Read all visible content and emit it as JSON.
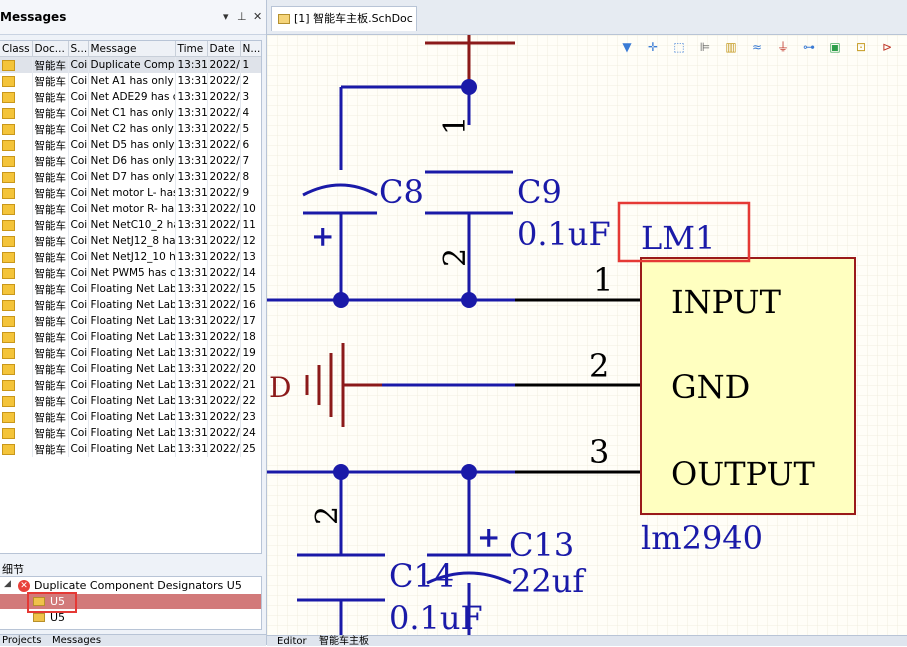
{
  "messages_panel": {
    "title": "Messages",
    "pin_icon": "pin-icon",
    "close_label": "✕",
    "dropdown_label": "▾",
    "columns": [
      "Class",
      "Doc...",
      "S...",
      "Message",
      "Time",
      "Date",
      "N..."
    ],
    "rows": [
      {
        "doc": "智能车",
        "src": "Coi",
        "msg": "Duplicate Comp",
        "time": "13:31",
        "date": "2022/",
        "no": "1"
      },
      {
        "doc": "智能车",
        "src": "Coi",
        "msg": "Net A1 has only",
        "time": "13:31",
        "date": "2022/",
        "no": "2"
      },
      {
        "doc": "智能车",
        "src": "Coi",
        "msg": "Net ADE29 has c",
        "time": "13:31",
        "date": "2022/",
        "no": "3"
      },
      {
        "doc": "智能车",
        "src": "Coi",
        "msg": "Net C1 has only",
        "time": "13:31",
        "date": "2022/",
        "no": "4"
      },
      {
        "doc": "智能车",
        "src": "Coi",
        "msg": "Net C2 has only",
        "time": "13:31",
        "date": "2022/",
        "no": "5"
      },
      {
        "doc": "智能车",
        "src": "Coi",
        "msg": "Net D5 has only",
        "time": "13:31",
        "date": "2022/",
        "no": "6"
      },
      {
        "doc": "智能车",
        "src": "Coi",
        "msg": "Net D6 has only",
        "time": "13:31",
        "date": "2022/",
        "no": "7"
      },
      {
        "doc": "智能车",
        "src": "Coi",
        "msg": "Net D7 has only",
        "time": "13:31",
        "date": "2022/",
        "no": "8"
      },
      {
        "doc": "智能车",
        "src": "Coi",
        "msg": "Net motor L- has",
        "time": "13:31",
        "date": "2022/",
        "no": "9"
      },
      {
        "doc": "智能车",
        "src": "Coi",
        "msg": "Net motor R- ha",
        "time": "13:31",
        "date": "2022/",
        "no": "10"
      },
      {
        "doc": "智能车",
        "src": "Coi",
        "msg": "Net NetC10_2 ha",
        "time": "13:31",
        "date": "2022/",
        "no": "11"
      },
      {
        "doc": "智能车",
        "src": "Coi",
        "msg": "Net NetJ12_8 ha",
        "time": "13:31",
        "date": "2022/",
        "no": "12"
      },
      {
        "doc": "智能车",
        "src": "Coi",
        "msg": "Net NetJ12_10 h",
        "time": "13:31",
        "date": "2022/",
        "no": "13"
      },
      {
        "doc": "智能车",
        "src": "Coi",
        "msg": "Net PWM5 has c",
        "time": "13:31",
        "date": "2022/",
        "no": "14"
      },
      {
        "doc": "智能车",
        "src": "Coi",
        "msg": "Floating Net Lab",
        "time": "13:31",
        "date": "2022/",
        "no": "15"
      },
      {
        "doc": "智能车",
        "src": "Coi",
        "msg": "Floating Net Lab",
        "time": "13:31",
        "date": "2022/",
        "no": "16"
      },
      {
        "doc": "智能车",
        "src": "Coi",
        "msg": "Floating Net Lab",
        "time": "13:31",
        "date": "2022/",
        "no": "17"
      },
      {
        "doc": "智能车",
        "src": "Coi",
        "msg": "Floating Net Lab",
        "time": "13:31",
        "date": "2022/",
        "no": "18"
      },
      {
        "doc": "智能车",
        "src": "Coi",
        "msg": "Floating Net Lab",
        "time": "13:31",
        "date": "2022/",
        "no": "19"
      },
      {
        "doc": "智能车",
        "src": "Coi",
        "msg": "Floating Net Lab",
        "time": "13:31",
        "date": "2022/",
        "no": "20"
      },
      {
        "doc": "智能车",
        "src": "Coi",
        "msg": "Floating Net Lab",
        "time": "13:31",
        "date": "2022/",
        "no": "21"
      },
      {
        "doc": "智能车",
        "src": "Coi",
        "msg": "Floating Net Lab",
        "time": "13:31",
        "date": "2022/",
        "no": "22"
      },
      {
        "doc": "智能车",
        "src": "Coi",
        "msg": "Floating Net Lab",
        "time": "13:31",
        "date": "2022/",
        "no": "23"
      },
      {
        "doc": "智能车",
        "src": "Coi",
        "msg": "Floating Net Lab",
        "time": "13:31",
        "date": "2022/",
        "no": "24"
      },
      {
        "doc": "智能车",
        "src": "Coi",
        "msg": "Floating Net Lab",
        "time": "13:31",
        "date": "2022/",
        "no": "25"
      }
    ],
    "detail_label": "细节",
    "detail_tree": {
      "root": "Duplicate Component Designators U5",
      "children": [
        "U5",
        "U5"
      ]
    },
    "bottom_tabs": [
      "Projects",
      "Messages"
    ]
  },
  "document": {
    "tab_label": "[1] 智能车主板.SchDoc",
    "bottom_tabs": [
      "Editor",
      "智能车主板"
    ]
  },
  "toolbar_icons": [
    "filter-icon",
    "crosshair-icon",
    "select-rect-icon",
    "align-icon",
    "component-icon",
    "wire-icon",
    "ground-icon",
    "bus-icon",
    "harness-icon",
    "netlabel-icon",
    "overflow-icon"
  ],
  "schematic": {
    "components": [
      {
        "designator": "C8",
        "value": ""
      },
      {
        "designator": "C9",
        "value": "0.1uF"
      },
      {
        "designator": "LM1",
        "value": "lm2940",
        "pins": [
          {
            "num": "1",
            "name": "INPUT"
          },
          {
            "num": "2",
            "name": "GND"
          },
          {
            "num": "3",
            "name": "OUTPUT"
          }
        ]
      },
      {
        "designator": "C13",
        "value": "22uf"
      },
      {
        "designator": "C14",
        "value": "0.1uF"
      }
    ],
    "pin_numbers_vertical": [
      "1",
      "2",
      "2"
    ],
    "plus_signs": [
      "+",
      "+"
    ],
    "partial_label": "D"
  },
  "colors": {
    "wire": "#1a1aa8",
    "part_body": "#ffffc0",
    "part_border": "#9a1a1a",
    "highlight_box": "#e53935",
    "grid_bg": "#fffef8"
  }
}
